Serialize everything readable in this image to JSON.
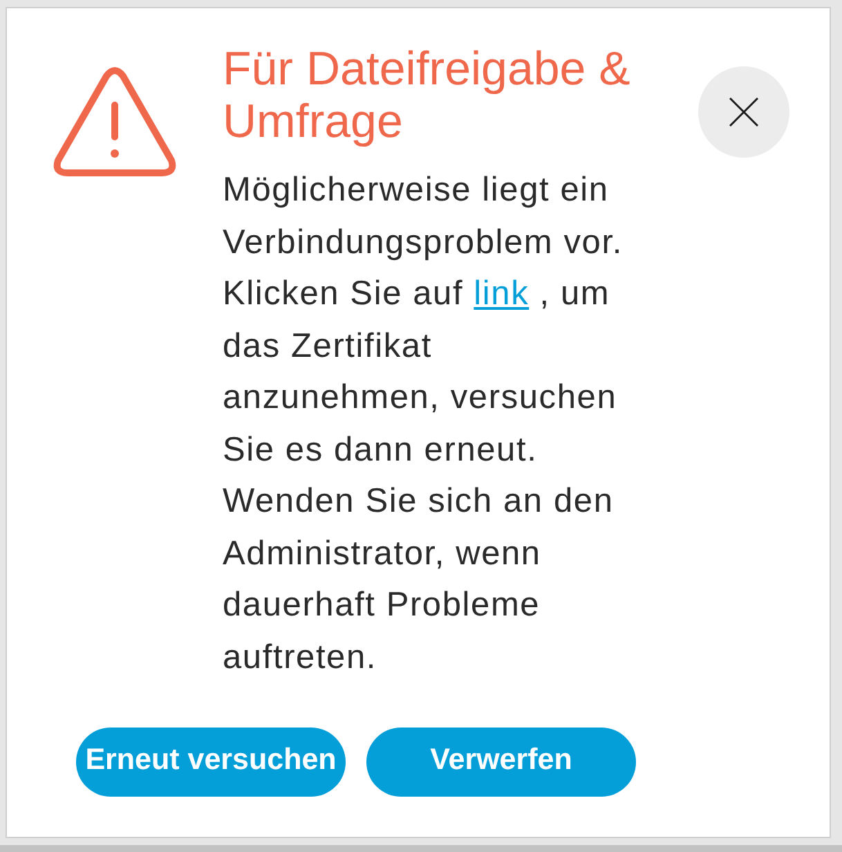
{
  "dialog": {
    "title": "Für Dateifreigabe & Umfrage",
    "message": {
      "before": "Möglicherweise liegt ein Verbindungsproblem vor. Klicken Sie auf ",
      "link": "link",
      "after": " , um das Zertifikat anzunehmen, versuchen Sie es dann erneut. Wenden Sie sich an den Administrator, wenn dauerhaft Probleme auftreten."
    }
  },
  "buttons": [
    {
      "label": "Erneut versuchen"
    },
    {
      "label": "Verwerfen"
    }
  ]
}
